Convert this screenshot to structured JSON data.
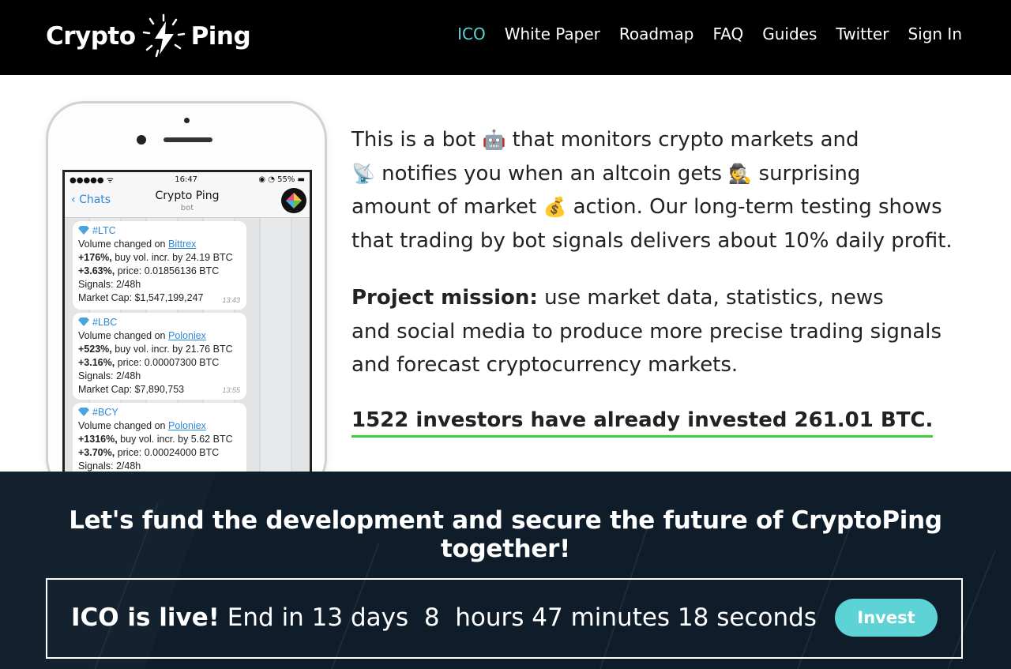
{
  "header": {
    "logo_left": "Crypto",
    "logo_right": "Ping",
    "nav": [
      {
        "label": "ICO",
        "active": true
      },
      {
        "label": "White Paper"
      },
      {
        "label": "Roadmap"
      },
      {
        "label": "FAQ"
      },
      {
        "label": "Guides"
      },
      {
        "label": "Twitter"
      },
      {
        "label": "Sign In"
      }
    ]
  },
  "phone": {
    "status_time": "16:47",
    "status_dots": "●●●●● ᯤ",
    "status_battery": "◉ ◔ 55% ▬",
    "back_label": "Chats",
    "chat_title": "Crypto Ping",
    "chat_subtitle": "bot",
    "messages": [
      {
        "tag": "#LTC",
        "prefix": "Volume changed on ",
        "exchange": "Bittrex",
        "line2_bold": "+176%,",
        "line2_rest": " buy vol. incr. by 24.19 BTC",
        "line3_bold": "+3.63%,",
        "line3_rest": " price: 0.01856136 BTC",
        "signals": "Signals: 2/48h",
        "cap": "Market Cap: $1,547,199,247",
        "time": "13:43"
      },
      {
        "tag": "#LBC",
        "prefix": "Volume changed on ",
        "exchange": "Poloniex",
        "line2_bold": "+523%,",
        "line2_rest": " buy vol. incr. by 21.76 BTC",
        "line3_bold": "+3.16%,",
        "line3_rest": " price: 0.00007300 BTC",
        "signals": "Signals: 2/48h",
        "cap": "Market Cap: $7,890,753",
        "time": "13:55"
      },
      {
        "tag": "#BCY",
        "prefix": "Volume changed on ",
        "exchange": "Poloniex",
        "line2_bold": "+1316%,",
        "line2_rest": " buy vol. incr. by 5.62 BTC",
        "line3_bold": "+3.70%,",
        "line3_rest": " price: 0.00024000 BTC",
        "signals": "Signals: 2/48h"
      }
    ]
  },
  "intro": {
    "t1": "This is a bot",
    "e1": "🤖",
    "t2": "that monitors crypto markets and",
    "e2": "📡",
    "t3": "notifies you when an altcoin gets",
    "e3": "🕵",
    "t4": "surprising",
    "t5": "amount of market",
    "e4": "💰",
    "t6": "action. Our long-term testing shows",
    "t7": "that trading by bot signals delivers about 10% daily profit."
  },
  "mission": {
    "label": "Project mission:",
    "line1": "use market data, statistics, news",
    "line2": "and social media to produce more precise trading signals",
    "line3": "and forecast cryptocurrency markets."
  },
  "investors_text": "1522 investors have already invested 261.01 BTC.",
  "band": {
    "headline": "Let's fund the development and secure the future of CryptoPing together!",
    "live_label": "ICO is live!",
    "countdown_text": "End in 13 days  8  hours 47 minutes 18 seconds",
    "invest_label": "Invest"
  },
  "colors": {
    "accent": "#5ed3d6",
    "underline": "#3ccf3c",
    "band_bg": "#0f1d2b",
    "header_bg": "#000000"
  }
}
